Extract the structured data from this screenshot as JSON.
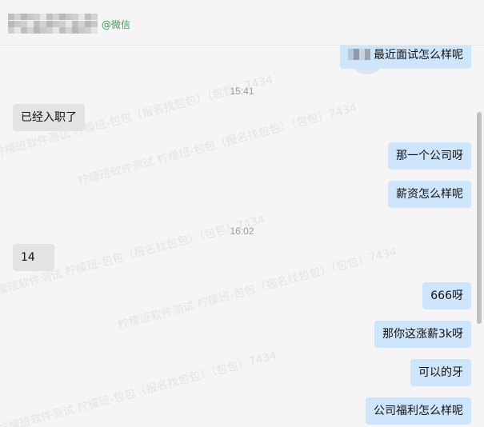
{
  "header": {
    "contact_tag": "@微信"
  },
  "watermark_text": "柠檬班软件测试 柠檬班-包包（报名找包包）（包包）7434",
  "messages": [
    {
      "side": "right",
      "text": "最近面试怎么样呢",
      "has_blurred_prefix": true
    },
    {
      "type": "time",
      "text": "15:41"
    },
    {
      "side": "left",
      "text": "已经入职了"
    },
    {
      "side": "right",
      "text": "那一个公司呀"
    },
    {
      "side": "right",
      "text": "薪资怎么样呢"
    },
    {
      "type": "time",
      "text": "16:02"
    },
    {
      "side": "left",
      "text": "14"
    },
    {
      "side": "right",
      "text": "666呀"
    },
    {
      "side": "right",
      "text": "那你这涨薪3k呀"
    },
    {
      "side": "right",
      "text": "可以的牙"
    },
    {
      "side": "right",
      "text": "公司福利怎么样呢"
    }
  ],
  "colors": {
    "background": "#f5f5f7",
    "bubble_left": "#e3e3e5",
    "bubble_right": "#cfe5fb",
    "wechat_tag": "#3a9e4f"
  }
}
